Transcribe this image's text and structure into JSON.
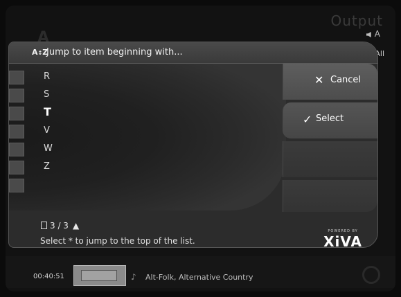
{
  "background": {
    "output_label": "Output",
    "volume_label": "A",
    "filter_label": "All"
  },
  "dialog": {
    "header_icon": "A-Z",
    "title": "Jump to item beginning with...",
    "items": [
      {
        "label": "R",
        "selected": false
      },
      {
        "label": "S",
        "selected": false
      },
      {
        "label": "T",
        "selected": true
      },
      {
        "label": "V",
        "selected": false
      },
      {
        "label": "W",
        "selected": false
      },
      {
        "label": "Z",
        "selected": false
      },
      {
        "label": "",
        "selected": false
      }
    ],
    "buttons": {
      "cancel_label": "Cancel",
      "select_label": "Select"
    },
    "pager": "3 / 3",
    "hint": "Select * to jump to the top of the list.",
    "brand_powered": "POWERED BY",
    "brand_name": "XiVA"
  },
  "now_playing": {
    "time": "00:40:51",
    "genre": "Alt-Folk, Alternative Country"
  },
  "icons": [
    "az-sort-icon",
    "cancel-x-icon",
    "check-icon",
    "page-icon",
    "up-arrow-icon",
    "speaker-icon",
    "music-note-icon",
    "album-art",
    "settings-icon"
  ]
}
